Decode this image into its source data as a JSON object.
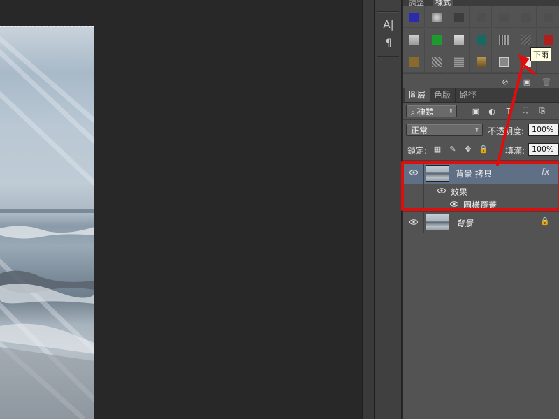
{
  "styles_panel": {
    "tabs": [
      "調整",
      "樣式"
    ],
    "active_tab": "樣式",
    "tooltip": "下雨",
    "swatches": [
      {
        "name": "blue-swatch",
        "color": "#2b2bb0"
      },
      {
        "name": "gray-gradient-swatch",
        "color": "#9a9a9a"
      },
      {
        "name": "dark-gray-swatch",
        "color": "#3d3d3d"
      },
      {
        "name": "empty-swatch-1",
        "color": "#555555"
      },
      {
        "name": "empty-swatch-2",
        "color": "#555555"
      },
      {
        "name": "empty-swatch-3",
        "color": "#555555"
      },
      {
        "name": "empty-swatch-4",
        "color": "#555555"
      },
      {
        "name": "light-gray-swatch",
        "color": "#b3b3b3"
      },
      {
        "name": "green-swatch",
        "color": "#1e9b2e"
      },
      {
        "name": "silver-swatch",
        "color": "#b8b8b8"
      },
      {
        "name": "teal-swatch",
        "color": "#166a62"
      },
      {
        "name": "grid-pattern-swatch",
        "color": "#8a8a8a"
      },
      {
        "name": "rain-pattern-swatch",
        "color": "#5a5a5a"
      },
      {
        "name": "red-swatch",
        "color": "#b01e1e"
      },
      {
        "name": "gold-swatch",
        "color": "#8a6a2a"
      },
      {
        "name": "texture-pattern-swatch",
        "color": "#777777"
      },
      {
        "name": "noise-pattern-swatch",
        "color": "#8b8b8b"
      },
      {
        "name": "bronze-swatch",
        "color": "#9a7a3a"
      },
      {
        "name": "framed-gray-swatch",
        "color": "#888888"
      },
      {
        "name": "white-swatch",
        "color": "#e8e8e8"
      }
    ]
  },
  "layers_panel": {
    "tabs": [
      "圖層",
      "色版",
      "路徑"
    ],
    "active_tab": "圖層",
    "filter_kind": "種類",
    "blend_mode": "正常",
    "opacity_label": "不透明度:",
    "opacity_value": "100%",
    "lock_label": "鎖定:",
    "fill_label": "填滿:",
    "fill_value": "100%",
    "layers": [
      {
        "name": "背景 拷貝",
        "fx": "fx",
        "selected": true,
        "effects_label": "效果",
        "effect_items": [
          "圖樣覆蓋"
        ]
      },
      {
        "name": "背景",
        "locked": true
      }
    ]
  },
  "tools": {
    "type_tool": "A|",
    "paragraph": "¶"
  }
}
